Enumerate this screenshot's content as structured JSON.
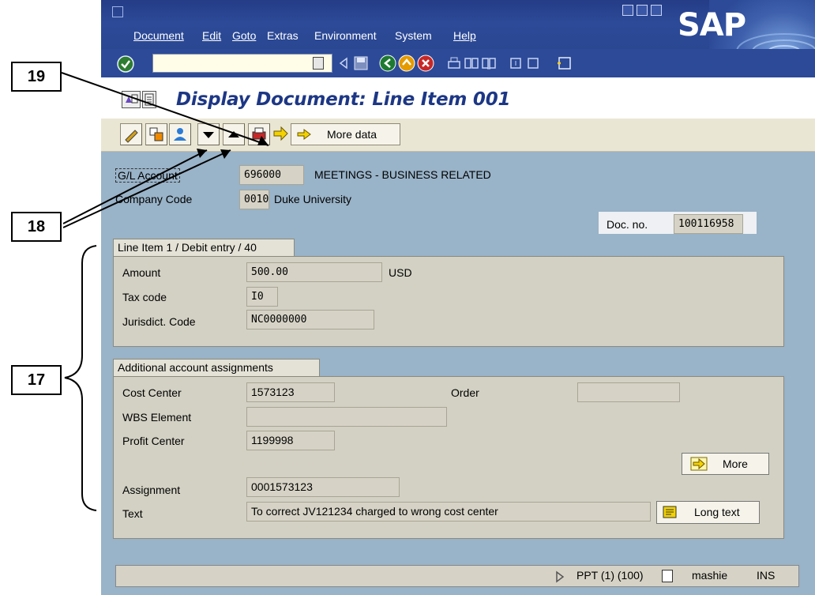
{
  "menu": {
    "items": [
      "Document",
      "Edit",
      "Goto",
      "Extras",
      "Environment",
      "System",
      "Help"
    ]
  },
  "logo": "SAP",
  "title": "Display Document: Line Item 001",
  "toolbar": {
    "more_data_label": "More data"
  },
  "header": {
    "gl_account_label": "G/L Account",
    "gl_account_value": "696000",
    "gl_account_desc": "MEETINGS - BUSINESS RELATED",
    "company_code_label": "Company Code",
    "company_code_value": "0010",
    "company_code_desc": "Duke University",
    "doc_no_label": "Doc. no.",
    "doc_no_value": "100116958"
  },
  "line_item": {
    "group_title": "Line Item 1 / Debit entry / 40",
    "amount_label": "Amount",
    "amount_value": "500.00",
    "currency": "USD",
    "tax_code_label": "Tax code",
    "tax_code_value": "I0",
    "jurisdict_label": "Jurisdict. Code",
    "jurisdict_value": "NC0000000"
  },
  "assignments": {
    "group_title": "Additional account assignments",
    "cost_center_label": "Cost Center",
    "cost_center_value": "1573123",
    "order_label": "Order",
    "order_value": "",
    "wbs_label": "WBS Element",
    "wbs_value": "",
    "profit_center_label": "Profit Center",
    "profit_center_value": "1199998",
    "more_label": "More",
    "assignment_label": "Assignment",
    "assignment_value": "0001573123",
    "text_label": "Text",
    "text_value": "To correct JV121234 charged to wrong cost center",
    "long_text_label": "Long text"
  },
  "status": {
    "system": "PPT (1) (100)",
    "user": "mashie",
    "mode": "INS"
  },
  "callouts": {
    "c19": "19",
    "c18": "18",
    "c17": "17"
  },
  "colors": {
    "title_blue": "#1d3785",
    "menubar_blue": "#2c4a98",
    "content_bg": "#99b3c8",
    "field_bg": "#d6d3c6",
    "command_field_bg": "#fffde7"
  }
}
